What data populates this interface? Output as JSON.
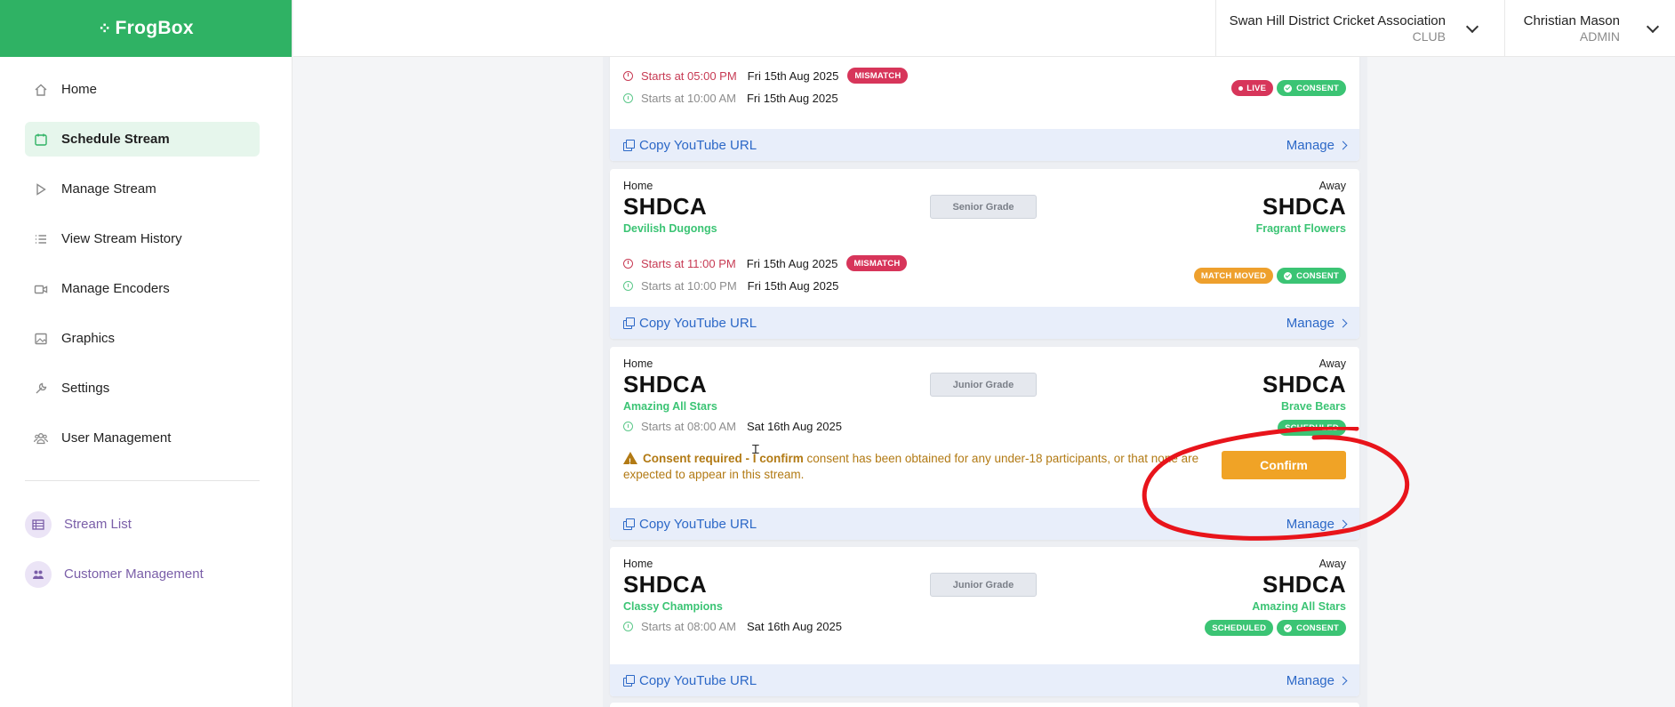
{
  "app": {
    "logo": "FrogBox"
  },
  "header": {
    "org_name": "Swan Hill District Cricket Association",
    "org_role": "CLUB",
    "user_name": "Christian Mason",
    "user_role": "ADMIN"
  },
  "sidebar": {
    "items": [
      {
        "label": "Home",
        "icon": "home-icon"
      },
      {
        "label": "Schedule Stream",
        "icon": "calendar-icon",
        "active": true
      },
      {
        "label": "Manage Stream",
        "icon": "play-icon"
      },
      {
        "label": "View Stream History",
        "icon": "list-icon"
      },
      {
        "label": "Manage Encoders",
        "icon": "camera-icon"
      },
      {
        "label": "Graphics",
        "icon": "image-icon"
      },
      {
        "label": "Settings",
        "icon": "wrench-icon"
      },
      {
        "label": "User Management",
        "icon": "users-icon"
      }
    ],
    "admin_items": [
      {
        "label": "Stream List",
        "icon": "table-icon"
      },
      {
        "label": "Customer Management",
        "icon": "customers-icon"
      }
    ]
  },
  "common": {
    "home_label": "Home",
    "away_label": "Away",
    "copy_url": "Copy YouTube URL",
    "manage": "Manage"
  },
  "cards": [
    {
      "time1": "Starts at 05:00 PM",
      "date1": "Fri 15th Aug 2025",
      "flag": "MISMATCH",
      "time2": "Starts at 10:00 AM",
      "date2": "Fri 15th Aug 2025",
      "badges": [
        "LIVE",
        "CONSENT"
      ]
    },
    {
      "home_code": "SHDCA",
      "home_name": "Devilish Dugongs",
      "grade": "Senior Grade",
      "away_code": "SHDCA",
      "away_name": "Fragrant Flowers",
      "time1": "Starts at 11:00 PM",
      "date1": "Fri 15th Aug 2025",
      "flag": "MISMATCH",
      "time2": "Starts at 10:00 PM",
      "date2": "Fri 15th Aug 2025",
      "badges": [
        "MATCH MOVED",
        "CONSENT"
      ]
    },
    {
      "home_code": "SHDCA",
      "home_name": "Amazing All Stars",
      "grade": "Junior Grade",
      "away_code": "SHDCA",
      "away_name": "Brave Bears",
      "time1": "Starts at 08:00 AM",
      "date1": "Sat 16th Aug 2025",
      "badges": [
        "SCHEDULED"
      ],
      "consent_title": "Consent required - I confirm",
      "consent_text": "consent has been obtained for any under-18 participants, or that none are expected to appear in this stream.",
      "confirm_label": "Confirm"
    },
    {
      "home_code": "SHDCA",
      "home_name": "Classy Champions",
      "grade": "Junior Grade",
      "away_code": "SHDCA",
      "away_name": "Amazing All Stars",
      "time1": "Starts at 08:00 AM",
      "date1": "Sat 16th Aug 2025",
      "badges": [
        "SCHEDULED",
        "CONSENT"
      ]
    }
  ],
  "colors": {
    "brand": "#2fb264",
    "link": "#2c68c7",
    "mismatch": "#d7355a",
    "consent": "#3bc474",
    "warning": "#f0a326",
    "annotation": "#e8141b"
  }
}
